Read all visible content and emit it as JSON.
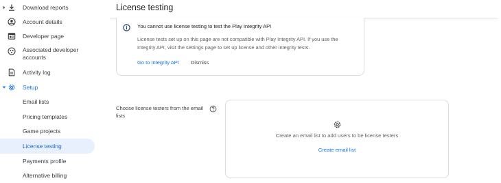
{
  "sidebar": {
    "items": [
      {
        "label": "Download reports",
        "icon": "download-icon"
      },
      {
        "label": "Account details",
        "icon": "account-circle-icon"
      },
      {
        "label": "Developer page",
        "icon": "developer-page-icon"
      },
      {
        "label": "Associated developer accounts",
        "icon": "associated-accounts-icon"
      },
      {
        "label": "Activity log",
        "icon": "activity-log-icon"
      },
      {
        "label": "Setup",
        "icon": "gear-icon"
      }
    ],
    "subitems": [
      {
        "label": "Email lists"
      },
      {
        "label": "Pricing templates"
      },
      {
        "label": "Game projects"
      },
      {
        "label": "License testing"
      },
      {
        "label": "Payments profile"
      },
      {
        "label": "Alternative billing"
      }
    ],
    "accent_color": "#1a73e8",
    "selected_bg": "#e8f0fe"
  },
  "main": {
    "title": "License testing",
    "banner": {
      "title": "You cannot use license testing to test the Play Integrity API",
      "body": "License tests set up on this page are not compatible with Play Integrity API. If you use the Integrity API, visit the settings page to set up license and other integrity tests.",
      "link_label": "Go to Integrity API",
      "dismiss_label": "Dismiss"
    },
    "testers": {
      "label": "Choose license testers from the email lists",
      "empty_text": "Create an email list to add users to be license testers",
      "create_link": "Create email list"
    }
  }
}
